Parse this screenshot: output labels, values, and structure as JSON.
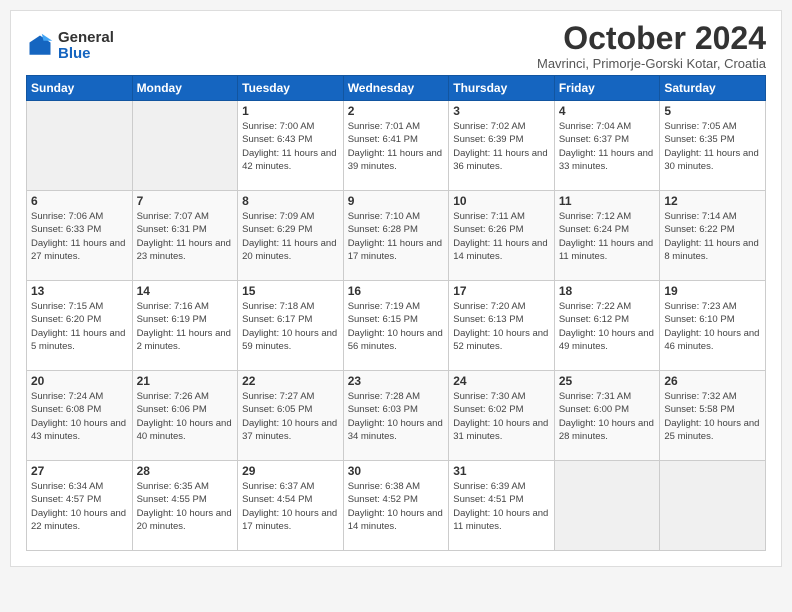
{
  "header": {
    "logo_general": "General",
    "logo_blue": "Blue",
    "month": "October 2024",
    "location": "Mavrinci, Primorje-Gorski Kotar, Croatia"
  },
  "days_of_week": [
    "Sunday",
    "Monday",
    "Tuesday",
    "Wednesday",
    "Thursday",
    "Friday",
    "Saturday"
  ],
  "weeks": [
    [
      {
        "day": "",
        "info": ""
      },
      {
        "day": "",
        "info": ""
      },
      {
        "day": "1",
        "info": "Sunrise: 7:00 AM\nSunset: 6:43 PM\nDaylight: 11 hours and 42 minutes."
      },
      {
        "day": "2",
        "info": "Sunrise: 7:01 AM\nSunset: 6:41 PM\nDaylight: 11 hours and 39 minutes."
      },
      {
        "day": "3",
        "info": "Sunrise: 7:02 AM\nSunset: 6:39 PM\nDaylight: 11 hours and 36 minutes."
      },
      {
        "day": "4",
        "info": "Sunrise: 7:04 AM\nSunset: 6:37 PM\nDaylight: 11 hours and 33 minutes."
      },
      {
        "day": "5",
        "info": "Sunrise: 7:05 AM\nSunset: 6:35 PM\nDaylight: 11 hours and 30 minutes."
      }
    ],
    [
      {
        "day": "6",
        "info": "Sunrise: 7:06 AM\nSunset: 6:33 PM\nDaylight: 11 hours and 27 minutes."
      },
      {
        "day": "7",
        "info": "Sunrise: 7:07 AM\nSunset: 6:31 PM\nDaylight: 11 hours and 23 minutes."
      },
      {
        "day": "8",
        "info": "Sunrise: 7:09 AM\nSunset: 6:29 PM\nDaylight: 11 hours and 20 minutes."
      },
      {
        "day": "9",
        "info": "Sunrise: 7:10 AM\nSunset: 6:28 PM\nDaylight: 11 hours and 17 minutes."
      },
      {
        "day": "10",
        "info": "Sunrise: 7:11 AM\nSunset: 6:26 PM\nDaylight: 11 hours and 14 minutes."
      },
      {
        "day": "11",
        "info": "Sunrise: 7:12 AM\nSunset: 6:24 PM\nDaylight: 11 hours and 11 minutes."
      },
      {
        "day": "12",
        "info": "Sunrise: 7:14 AM\nSunset: 6:22 PM\nDaylight: 11 hours and 8 minutes."
      }
    ],
    [
      {
        "day": "13",
        "info": "Sunrise: 7:15 AM\nSunset: 6:20 PM\nDaylight: 11 hours and 5 minutes."
      },
      {
        "day": "14",
        "info": "Sunrise: 7:16 AM\nSunset: 6:19 PM\nDaylight: 11 hours and 2 minutes."
      },
      {
        "day": "15",
        "info": "Sunrise: 7:18 AM\nSunset: 6:17 PM\nDaylight: 10 hours and 59 minutes."
      },
      {
        "day": "16",
        "info": "Sunrise: 7:19 AM\nSunset: 6:15 PM\nDaylight: 10 hours and 56 minutes."
      },
      {
        "day": "17",
        "info": "Sunrise: 7:20 AM\nSunset: 6:13 PM\nDaylight: 10 hours and 52 minutes."
      },
      {
        "day": "18",
        "info": "Sunrise: 7:22 AM\nSunset: 6:12 PM\nDaylight: 10 hours and 49 minutes."
      },
      {
        "day": "19",
        "info": "Sunrise: 7:23 AM\nSunset: 6:10 PM\nDaylight: 10 hours and 46 minutes."
      }
    ],
    [
      {
        "day": "20",
        "info": "Sunrise: 7:24 AM\nSunset: 6:08 PM\nDaylight: 10 hours and 43 minutes."
      },
      {
        "day": "21",
        "info": "Sunrise: 7:26 AM\nSunset: 6:06 PM\nDaylight: 10 hours and 40 minutes."
      },
      {
        "day": "22",
        "info": "Sunrise: 7:27 AM\nSunset: 6:05 PM\nDaylight: 10 hours and 37 minutes."
      },
      {
        "day": "23",
        "info": "Sunrise: 7:28 AM\nSunset: 6:03 PM\nDaylight: 10 hours and 34 minutes."
      },
      {
        "day": "24",
        "info": "Sunrise: 7:30 AM\nSunset: 6:02 PM\nDaylight: 10 hours and 31 minutes."
      },
      {
        "day": "25",
        "info": "Sunrise: 7:31 AM\nSunset: 6:00 PM\nDaylight: 10 hours and 28 minutes."
      },
      {
        "day": "26",
        "info": "Sunrise: 7:32 AM\nSunset: 5:58 PM\nDaylight: 10 hours and 25 minutes."
      }
    ],
    [
      {
        "day": "27",
        "info": "Sunrise: 6:34 AM\nSunset: 4:57 PM\nDaylight: 10 hours and 22 minutes."
      },
      {
        "day": "28",
        "info": "Sunrise: 6:35 AM\nSunset: 4:55 PM\nDaylight: 10 hours and 20 minutes."
      },
      {
        "day": "29",
        "info": "Sunrise: 6:37 AM\nSunset: 4:54 PM\nDaylight: 10 hours and 17 minutes."
      },
      {
        "day": "30",
        "info": "Sunrise: 6:38 AM\nSunset: 4:52 PM\nDaylight: 10 hours and 14 minutes."
      },
      {
        "day": "31",
        "info": "Sunrise: 6:39 AM\nSunset: 4:51 PM\nDaylight: 10 hours and 11 minutes."
      },
      {
        "day": "",
        "info": ""
      },
      {
        "day": "",
        "info": ""
      }
    ]
  ]
}
